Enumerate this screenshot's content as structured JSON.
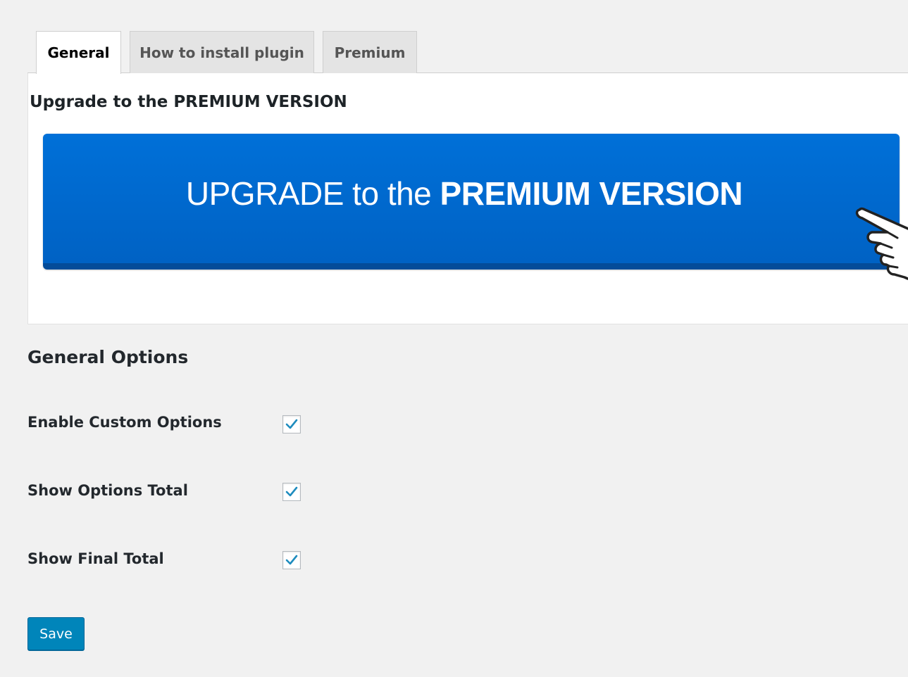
{
  "tabs": {
    "general": "General",
    "install": "How to install plugin",
    "premium": "Premium"
  },
  "panel": {
    "title": "Upgrade to the PREMIUM VERSION",
    "banner_light": "UPGRADE to the ",
    "banner_bold": "PREMIUM VERSION",
    "hand_icon": "pointing-hand-icon"
  },
  "general_options": {
    "title": "General Options",
    "options": [
      {
        "label": "Enable Custom Options",
        "checked": true
      },
      {
        "label": "Show Options Total",
        "checked": true
      },
      {
        "label": "Show Final Total",
        "checked": true
      }
    ]
  },
  "save_label": "Save",
  "colors": {
    "accent": "#0085ba",
    "banner": "#0066cc",
    "check": "#1e8cbe"
  }
}
